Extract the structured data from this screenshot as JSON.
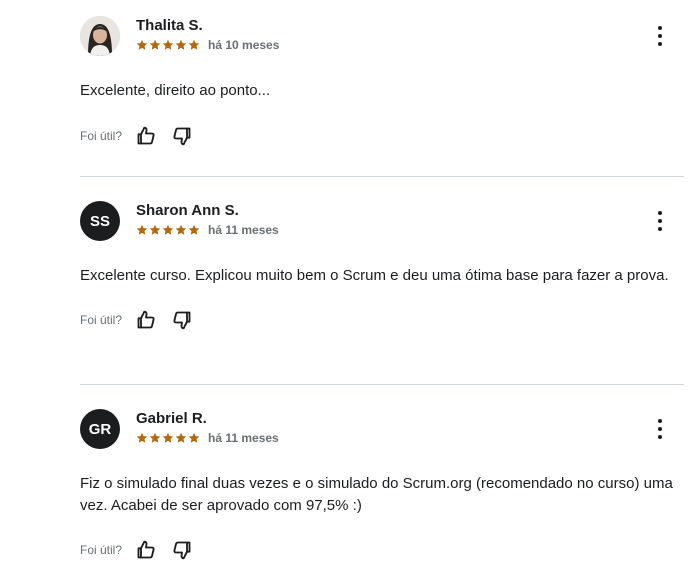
{
  "colors": {
    "star": "#b4690e",
    "text": "#1c1d1f",
    "muted": "#6a6f73",
    "divider": "#d1d7dc",
    "avatar_bg": "#1c1d1f"
  },
  "helpful_label": "Foi útil?",
  "reviews": [
    {
      "name": "Thalita S.",
      "avatar": "photo",
      "rating": 5,
      "date": "há 10 meses",
      "text": "Excelente, direito ao ponto..."
    },
    {
      "name": "Sharon Ann S.",
      "initials": "SS",
      "rating": 5,
      "date": "há 11 meses",
      "text": "Excelente curso. Explicou muito bem o Scrum e deu uma ótima base para fazer a prova."
    },
    {
      "name": "Gabriel R.",
      "initials": "GR",
      "rating": 5,
      "date": "há 11 meses",
      "text": "Fiz o simulado final duas vezes e o simulado do Scrum.org (recomendado no curso) uma vez. Acabei de ser aprovado com 97,5% :)"
    }
  ],
  "icons": {
    "more": "more-vertical-icon",
    "thumbs_up": "thumbs-up-icon",
    "thumbs_down": "thumbs-down-icon",
    "star": "star-icon"
  }
}
